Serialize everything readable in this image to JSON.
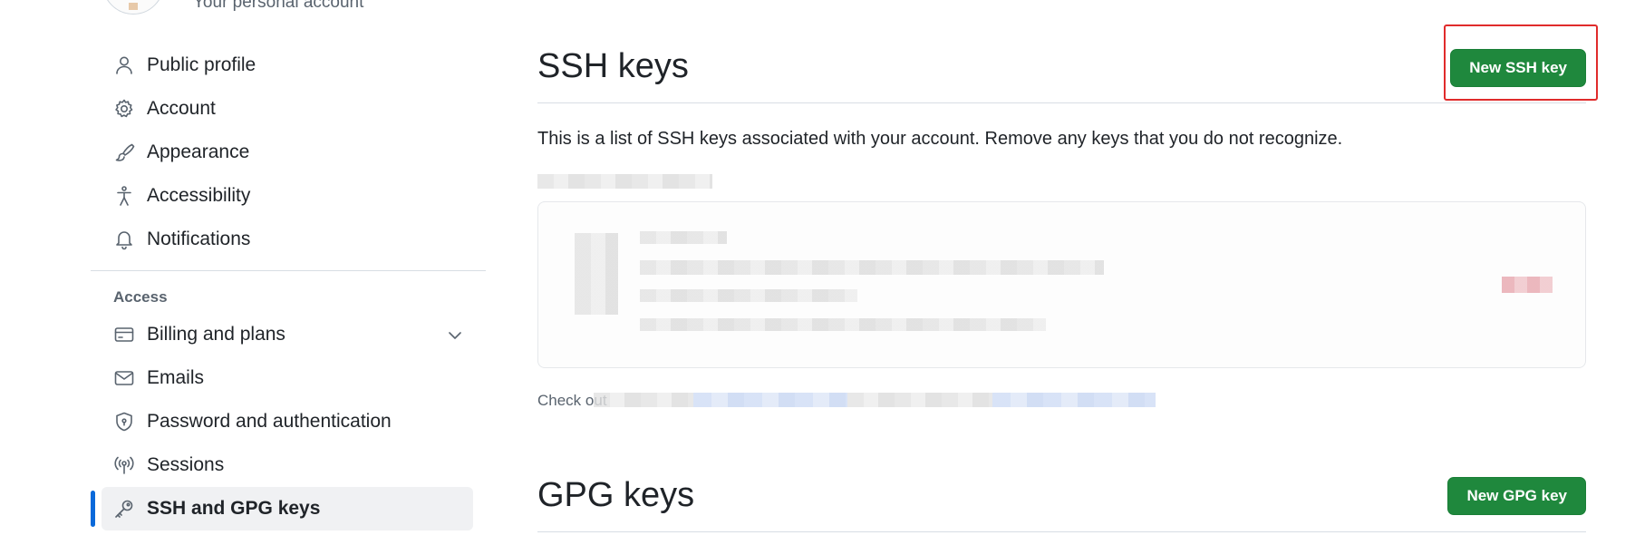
{
  "header": {
    "subtitle": "Your personal account"
  },
  "sidebar": {
    "items": [
      {
        "label": "Public profile",
        "icon": "person-icon"
      },
      {
        "label": "Account",
        "icon": "gear-icon"
      },
      {
        "label": "Appearance",
        "icon": "paintbrush-icon"
      },
      {
        "label": "Accessibility",
        "icon": "accessibility-icon"
      },
      {
        "label": "Notifications",
        "icon": "bell-icon"
      }
    ],
    "access_label": "Access",
    "access_items": [
      {
        "label": "Billing and plans",
        "icon": "credit-card-icon"
      },
      {
        "label": "Emails",
        "icon": "mail-icon"
      },
      {
        "label": "Password and authentication",
        "icon": "shield-lock-icon"
      },
      {
        "label": "Sessions",
        "icon": "broadcast-icon"
      },
      {
        "label": "SSH and GPG keys",
        "icon": "key-icon",
        "active": true
      }
    ]
  },
  "main": {
    "ssh": {
      "title": "SSH keys",
      "button_label": "New SSH key",
      "description": "This is a list of SSH keys associated with your account. Remove any keys that you do not recognize.",
      "footnote_prefix": "Check out"
    },
    "gpg": {
      "title": "GPG keys",
      "button_label": "New GPG key"
    }
  },
  "colors": {
    "primary_button": "#1f883d",
    "active_indicator": "#0969da",
    "highlight": "#e02b2b"
  }
}
